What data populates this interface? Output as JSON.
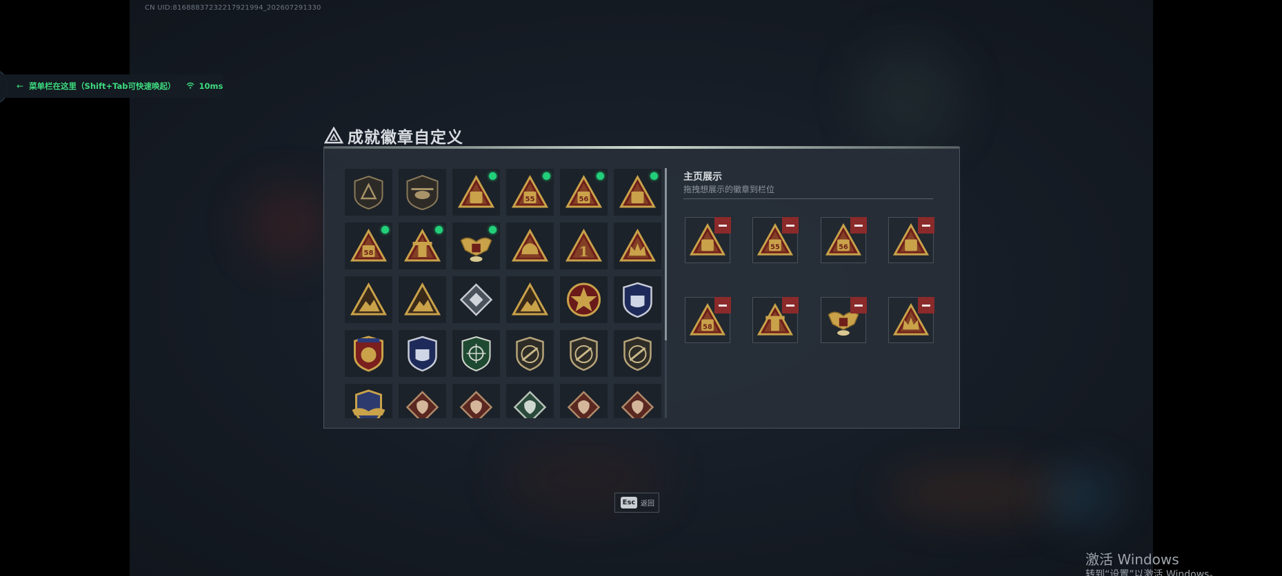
{
  "uid_text": "CN UID:816888372322179219­94_202607291330",
  "overlay": {
    "arrow_icon": "arrow-left-icon",
    "message": "菜单栏在这里（Shift+Tab可快速唤起）",
    "wifi_icon": "wifi-icon",
    "ping": "10ms",
    "color": "#3ddc7f"
  },
  "title": "成就徽章自定义",
  "title_icon": "triangle-emblem-icon",
  "badge_grid": {
    "rows": [
      [
        {
          "icon": "shield-triangle-badge",
          "new": false
        },
        {
          "icon": "helicopter-badge",
          "new": false
        },
        {
          "icon": "triangle-radio-badge",
          "new": true
        },
        {
          "icon": "triangle-55-badge",
          "new": true
        },
        {
          "icon": "triangle-56-badge",
          "new": true
        },
        {
          "icon": "triangle-ammo-badge",
          "new": true
        }
      ],
      [
        {
          "icon": "triangle-58-badge",
          "new": true
        },
        {
          "icon": "triangle-tower-badge",
          "new": true
        },
        {
          "icon": "eagle-badge",
          "new": true
        },
        {
          "icon": "triangle-helmet-badge",
          "new": false
        },
        {
          "icon": "triangle-1-badge",
          "new": false
        },
        {
          "icon": "triangle-crown-badge",
          "new": false
        }
      ],
      [
        {
          "icon": "triangle-soldier-badge",
          "new": false
        },
        {
          "icon": "triangle-mountain-badge",
          "new": false
        },
        {
          "icon": "silver-diamond-badge",
          "new": false
        },
        {
          "icon": "triangle-gun-badge",
          "new": false
        },
        {
          "icon": "red-star-medal-badge",
          "new": false
        },
        {
          "icon": "blue-shield-medal-badge",
          "new": false
        }
      ],
      [
        {
          "icon": "gold-shield-medal-badge",
          "new": false
        },
        {
          "icon": "blue-wolf-medal-badge",
          "new": false
        },
        {
          "icon": "green-crosshair-badge",
          "new": false
        },
        {
          "icon": "shield-rifle-badge",
          "new": false
        },
        {
          "icon": "shield-rifle-badge-2",
          "new": false
        },
        {
          "icon": "shield-rifle-badge-3",
          "new": false
        }
      ],
      [
        {
          "icon": "gold-wing-badge",
          "new": false
        },
        {
          "icon": "dragon-diamond-badge",
          "new": false
        },
        {
          "icon": "dragon-diamond-badge-2",
          "new": false
        },
        {
          "icon": "green-diamond-badge",
          "new": false
        },
        {
          "icon": "dragon-diamond-badge-3",
          "new": false
        },
        {
          "icon": "dragon-diamond-badge-4",
          "new": false
        }
      ]
    ]
  },
  "showcase": {
    "title": "主页展示",
    "subtitle": "拖拽想展示的徽章到栏位",
    "remove_icon": "minus-icon",
    "slots": [
      {
        "icon": "triangle-radio-badge"
      },
      {
        "icon": "triangle-55-badge"
      },
      {
        "icon": "triangle-56-badge"
      },
      {
        "icon": "triangle-ammo-badge"
      },
      {
        "icon": "triangle-58-badge"
      },
      {
        "icon": "triangle-tower-badge"
      },
      {
        "icon": "eagle-badge"
      },
      {
        "icon": "triangle-crown-badge"
      }
    ]
  },
  "esc": {
    "key": "Esc",
    "label": "返回"
  },
  "watermark": {
    "title": "激活 Windows",
    "subtitle": "转到“设置”以激活 Windows。"
  },
  "colors": {
    "new_dot": "#22d07a",
    "remove": "#8b2a2a",
    "badge_gold": "#c9a24a",
    "badge_red": "#6e1f1a"
  }
}
